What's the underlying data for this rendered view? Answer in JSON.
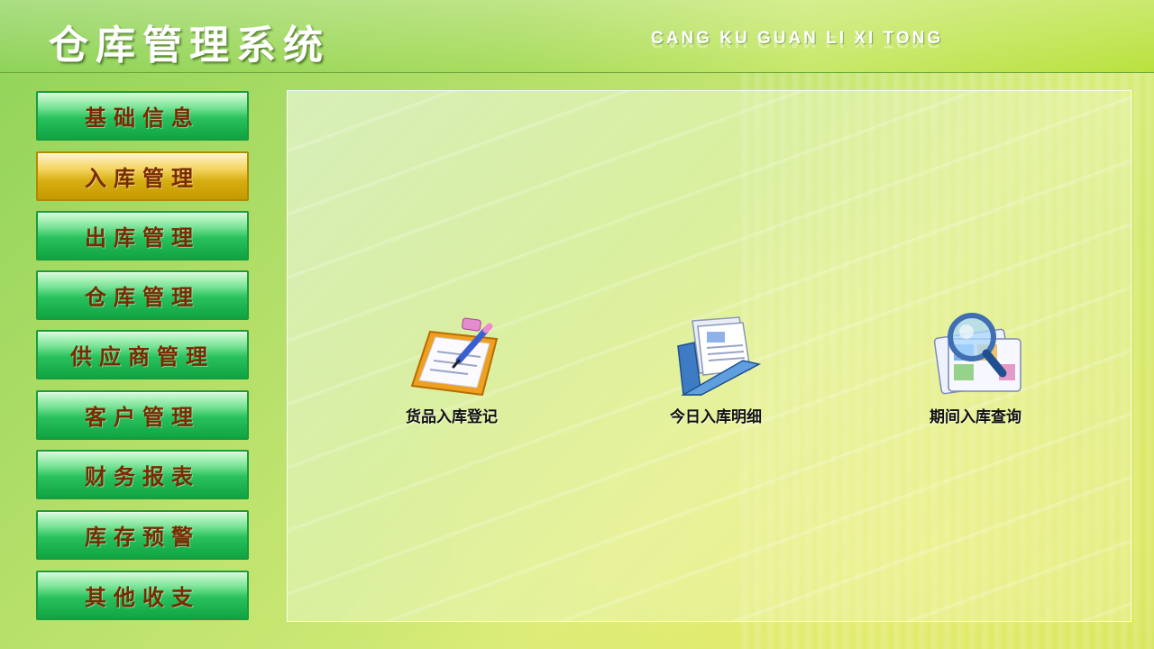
{
  "header": {
    "title": "仓库管理系统",
    "subtitle": "CANG KU GUAN LI XI TONG"
  },
  "sidebar": {
    "items": [
      {
        "label": "基础信息",
        "active": false
      },
      {
        "label": "入库管理",
        "active": true
      },
      {
        "label": "出库管理",
        "active": false
      },
      {
        "label": "仓库管理",
        "active": false
      },
      {
        "label": "供应商管理",
        "active": false
      },
      {
        "label": "客户管理",
        "active": false
      },
      {
        "label": "财务报表",
        "active": false
      },
      {
        "label": "库存预警",
        "active": false
      },
      {
        "label": "其他收支",
        "active": false
      }
    ]
  },
  "main": {
    "tools": [
      {
        "label": "货品入库登记",
        "icon": "clipboard-pen-icon"
      },
      {
        "label": "今日入库明细",
        "icon": "document-folder-icon"
      },
      {
        "label": "期间入库查询",
        "icon": "magnifier-search-icon"
      }
    ]
  },
  "colors": {
    "accent_green": "#29c15d",
    "active_gold": "#d7ae12",
    "nav_text": "#7a2a00"
  }
}
